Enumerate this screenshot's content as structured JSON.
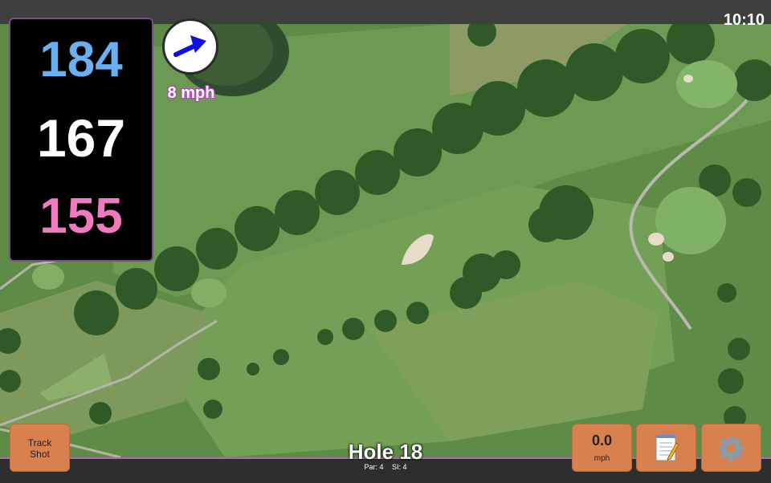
{
  "status": {
    "time": "10:10"
  },
  "distances": {
    "back": "184",
    "middle": "167",
    "front": "155",
    "colors": {
      "back": "#6ab0f0",
      "middle": "#ffffff",
      "front": "#f07ac0"
    }
  },
  "wind": {
    "speed": "8 mph",
    "direction_icon": "arrow-icon",
    "arrow_color": "#1010e0"
  },
  "hole": {
    "title": "Hole 18",
    "par": "Par: 4",
    "si": "SI: 4"
  },
  "buttons": {
    "track_shot": {
      "line1": "Track",
      "line2": "Shot"
    },
    "speed": {
      "value": "0.0",
      "unit": "mph"
    },
    "notes_icon": "notepad-icon",
    "settings_icon": "gear-icon",
    "color": "#d9804f"
  }
}
